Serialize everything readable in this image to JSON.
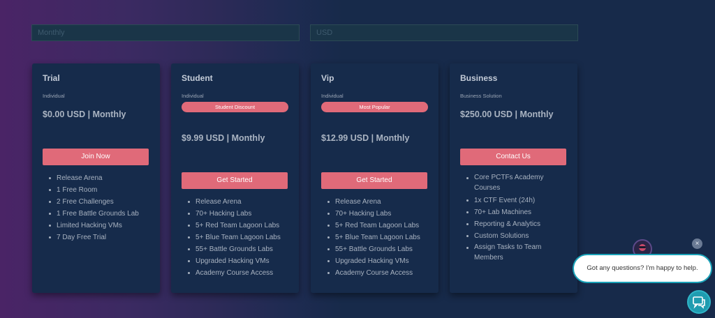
{
  "filters": {
    "period_placeholder": "Monthly",
    "currency_placeholder": "USD"
  },
  "plans": [
    {
      "name": "Trial",
      "audience": "Individual",
      "badge": "",
      "price": "$0.00 USD | Monthly",
      "button": "Join Now",
      "features": [
        "Release Arena",
        "1 Free Room",
        "2 Free Challenges",
        "1 Free Battle Grounds Lab",
        "Limited Hacking VMs",
        "7 Day Free Trial"
      ]
    },
    {
      "name": "Student",
      "audience": "Individual",
      "badge": "Student Discount",
      "price": "$9.99 USD | Monthly",
      "button": "Get Started",
      "features": [
        "Release Arena",
        "70+ Hacking Labs",
        "5+ Red Team Lagoon Labs",
        "5+ Blue Team Lagoon Labs",
        "55+ Battle Grounds Labs",
        "Upgraded Hacking VMs",
        "Academy Course Access"
      ]
    },
    {
      "name": "Vip",
      "audience": "Individual",
      "badge": "Most Popular",
      "price": "$12.99 USD | Monthly",
      "button": "Get Started",
      "features": [
        "Release Arena",
        "70+ Hacking Labs",
        "5+ Red Team Lagoon Labs",
        "5+ Blue Team Lagoon Labs",
        "55+ Battle Grounds Labs",
        "Upgraded Hacking VMs",
        "Academy Course Access"
      ]
    },
    {
      "name": "Business",
      "audience": "Business Solution",
      "badge": "",
      "price": "$250.00 USD | Monthly",
      "button": "Contact Us",
      "features": [
        "Core PCTFs Academy Courses",
        "1x CTF Event (24h)",
        "70+ Lab Machines",
        "Reporting & Analytics",
        "Custom Solutions",
        "Assign Tasks to Team Members"
      ]
    }
  ],
  "chat": {
    "message": "Got any questions? I'm happy to help.",
    "close_glyph": "×",
    "launcher_icon": "chat-bubbles-icon",
    "avatar_icon": "bot-avatar-icon"
  }
}
